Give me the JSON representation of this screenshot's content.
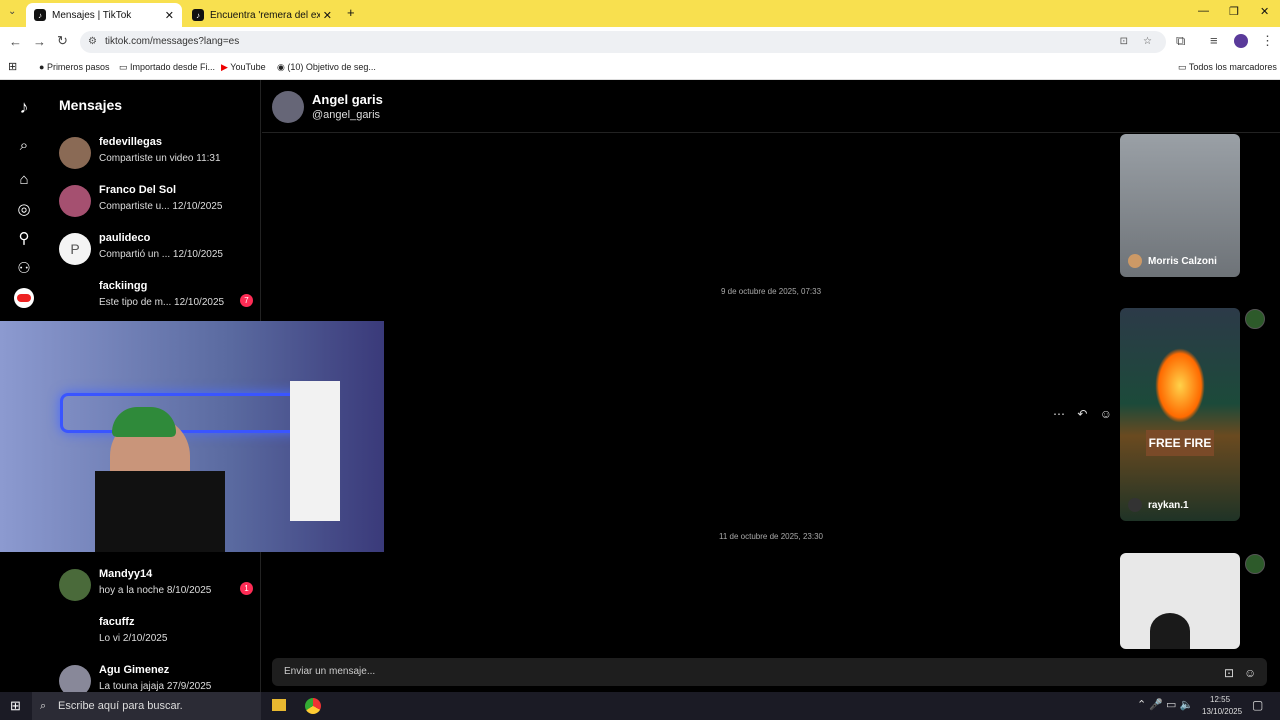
{
  "browser": {
    "tabs": [
      {
        "title": "Mensajes | TikTok",
        "active": true
      },
      {
        "title": "Encuentra 'remera del ex' en Ti",
        "active": false
      }
    ],
    "url": "tiktok.com/messages?lang=es",
    "bookmarks": [
      "Primeros pasos",
      "Importado desde Fi...",
      "YouTube",
      "(10) Objetivo de seg...",
      "Todos los marcadores"
    ]
  },
  "sidebar": {
    "title": "Mensajes",
    "conversations": [
      {
        "name": "fedevillegas",
        "preview": "Compartiste un video 11:31",
        "badge": ""
      },
      {
        "name": "Franco Del Sol",
        "preview": "Compartiste u...  12/10/2025",
        "badge": ""
      },
      {
        "name": "paulideco",
        "preview": "Compartió un ...  12/10/2025",
        "badge": ""
      },
      {
        "name": "fackiingg",
        "preview": "Este tipo de m...  12/10/2025",
        "badge": "7"
      },
      {
        "name": "Mandyy14",
        "preview": "hoy a la noche  8/10/2025",
        "badge": "1"
      },
      {
        "name": "facuffz",
        "preview": "Lo vi  2/10/2025",
        "badge": ""
      },
      {
        "name": "Agu Gimenez",
        "preview": "La touna jajaja  27/9/2025",
        "badge": ""
      }
    ]
  },
  "chat": {
    "name": "Angel garis",
    "handle": "@angel_garis",
    "timestamps": [
      "9 de octubre de 2025, 07:33",
      "11 de octubre de 2025, 23:30"
    ],
    "videos": [
      {
        "author": "Morris Calzoni"
      },
      {
        "author": "raykan.1",
        "overlay_text": "FREE FIRE"
      },
      {
        "author": ""
      }
    ],
    "input_placeholder": "Enviar un mensaje..."
  },
  "taskbar": {
    "search": "Escribe aquí para buscar.",
    "time": "12:55",
    "date": "13/10/2025"
  }
}
